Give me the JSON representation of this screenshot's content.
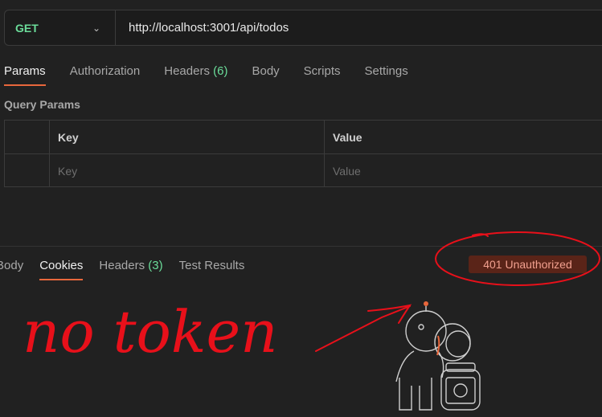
{
  "request": {
    "method": "GET",
    "url": "http://localhost:3001/api/todos"
  },
  "request_tabs": [
    {
      "label": "Params",
      "active": true
    },
    {
      "label": "Authorization"
    },
    {
      "label": "Headers",
      "count": "(6)"
    },
    {
      "label": "Body"
    },
    {
      "label": "Scripts"
    },
    {
      "label": "Settings"
    }
  ],
  "query_params": {
    "title": "Query Params",
    "columns": [
      "Key",
      "Value"
    ],
    "placeholder_key": "Key",
    "placeholder_value": "Value"
  },
  "response_tabs": [
    {
      "label": "Body"
    },
    {
      "label": "Cookies",
      "active": true
    },
    {
      "label": "Headers",
      "count": "(3)"
    },
    {
      "label": "Test Results"
    }
  ],
  "response": {
    "status": "401 Unauthorized"
  },
  "annotation": {
    "handwritten_text": "no token",
    "color": "#e8101a"
  },
  "colors": {
    "accent": "#e8673c",
    "method_green": "#6bdd9a",
    "error_bg": "#5a2418",
    "error_text": "#f2a08f"
  },
  "icons": [
    "chevron-down-icon",
    "astronaut-illustration"
  ]
}
